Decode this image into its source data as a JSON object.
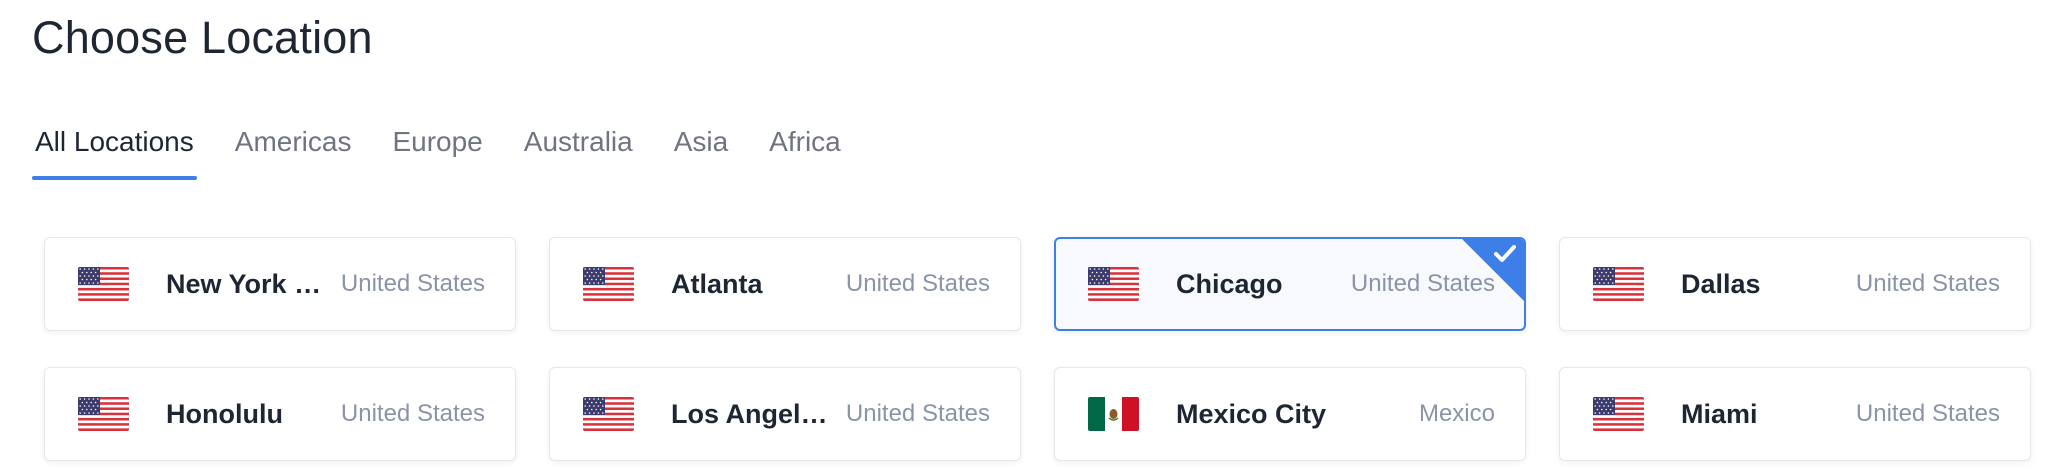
{
  "page": {
    "title": "Choose Location"
  },
  "tabs": [
    {
      "label": "All Locations",
      "active": true
    },
    {
      "label": "Americas",
      "active": false
    },
    {
      "label": "Europe",
      "active": false
    },
    {
      "label": "Australia",
      "active": false
    },
    {
      "label": "Asia",
      "active": false
    },
    {
      "label": "Africa",
      "active": false
    }
  ],
  "locations": [
    {
      "city": "New York (...",
      "country": "United States",
      "flag": "us-flag-icon",
      "selected": false
    },
    {
      "city": "Atlanta",
      "country": "United States",
      "flag": "us-flag-icon",
      "selected": false
    },
    {
      "city": "Chicago",
      "country": "United States",
      "flag": "us-flag-icon",
      "selected": true
    },
    {
      "city": "Dallas",
      "country": "United States",
      "flag": "us-flag-icon",
      "selected": false
    },
    {
      "city": "Honolulu",
      "country": "United States",
      "flag": "us-flag-icon",
      "selected": false
    },
    {
      "city": "Los Angeles",
      "country": "United States",
      "flag": "us-flag-icon",
      "selected": false
    },
    {
      "city": "Mexico City",
      "country": "Mexico",
      "flag": "mexico-flag-icon",
      "selected": false
    },
    {
      "city": "Miami",
      "country": "United States",
      "flag": "us-flag-icon",
      "selected": false
    }
  ],
  "colors": {
    "accent": "#3d7fe6",
    "text": "#1f2633",
    "muted": "#8a93a8",
    "tab_inactive": "#6f7480",
    "card_border": "#e4e7ec"
  }
}
